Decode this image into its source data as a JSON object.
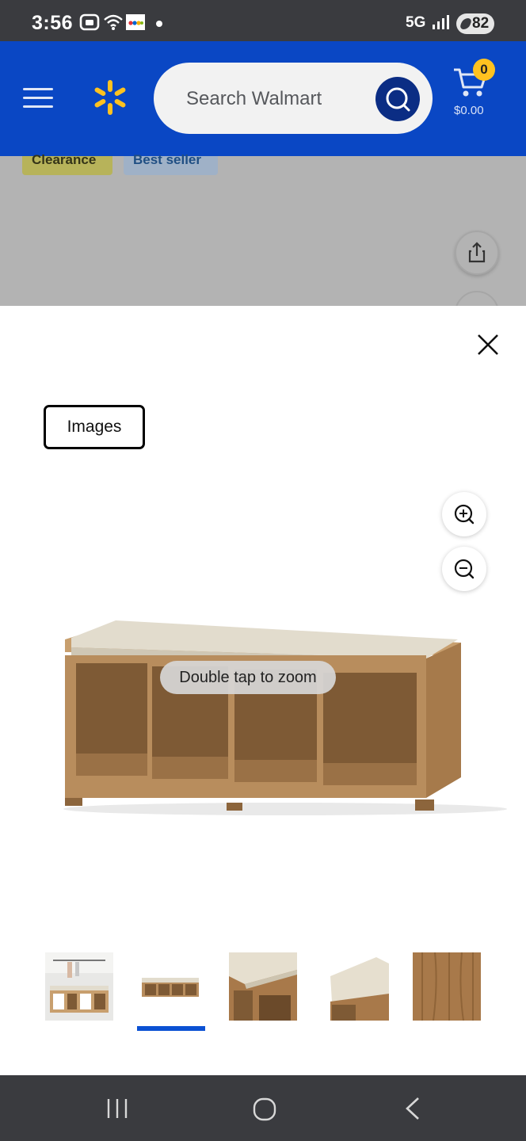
{
  "status_bar": {
    "time": "3:56",
    "notification_icons": [
      "screen-record-icon",
      "wifi-icon",
      "ebay-icon",
      "dot-icon"
    ],
    "network": "5G",
    "battery": "82"
  },
  "header": {
    "search_placeholder": "Search Walmart",
    "cart_count": "0",
    "cart_total": "$0.00",
    "brand_color": "#0a47c4",
    "accent_color": "#ffc220"
  },
  "background_page": {
    "tags": [
      "Clearance",
      "Best seller"
    ]
  },
  "modal": {
    "images_label": "Images",
    "double_tap_hint": "Double tap to zoom",
    "selected_thumbnail": 2,
    "thumbnails": [
      "room-scene",
      "bench-front",
      "cushion-detail",
      "corner-detail",
      "wood-grain"
    ]
  }
}
